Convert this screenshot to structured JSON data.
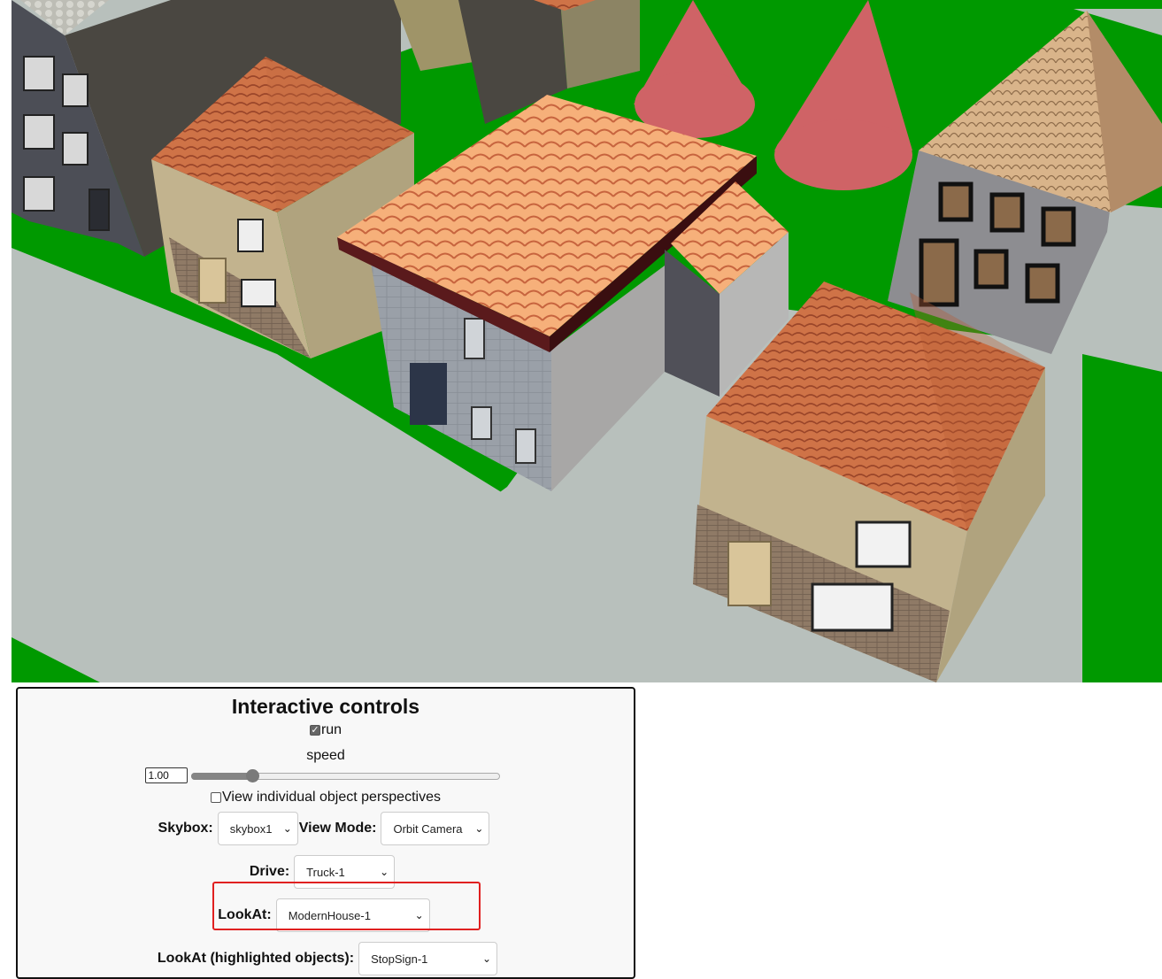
{
  "controls": {
    "title": "Interactive controls",
    "run_label": "run",
    "run_checked": true,
    "speed_label": "speed",
    "speed_value": "1.00",
    "speed_fraction": 0.2,
    "view_individual_label": "View individual object perspectives",
    "view_individual_checked": false,
    "skybox_label": "Skybox:",
    "skybox_value": "skybox1",
    "view_mode_label": "View Mode:",
    "view_mode_value": "Orbit Camera",
    "drive_label": "Drive:",
    "drive_value": "Truck-1",
    "lookat_label": "LookAt:",
    "lookat_value": "ModernHouse-1",
    "lookat_highlighted_label": "LookAt (highlighted objects):",
    "lookat_highlighted_value": "StopSign-1"
  },
  "scene": {
    "colors": {
      "grass": "#009900",
      "road": "#b8c0bc",
      "roof_tile": "#d2784a",
      "cone": "#cf6366",
      "wall_beige": "#c2b38e",
      "wall_grey": "#8d8d91"
    }
  },
  "highlight_color": "#e02020"
}
